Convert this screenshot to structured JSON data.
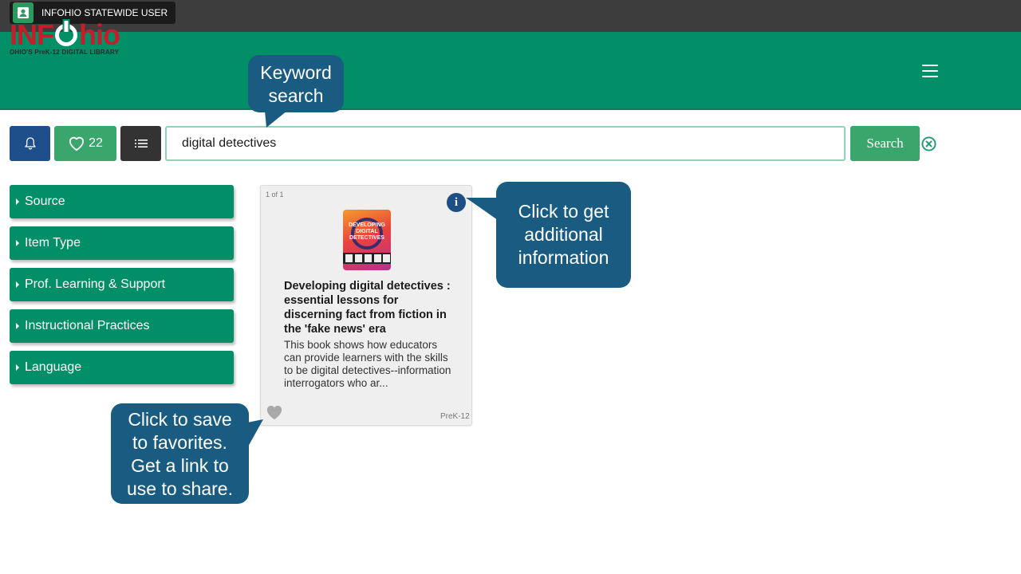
{
  "topbar": {
    "user_label": "INFOHIO STATEWIDE USER",
    "user_icon": "contact-card-icon"
  },
  "header": {
    "logo_left": "INF",
    "logo_right": "hio",
    "logo_tagline": "OHIO'S PreK-12 DIGITAL LIBRARY",
    "menu_icon": "hamburger-icon"
  },
  "toolbar": {
    "alerts_icon": "bell-icon",
    "favorites_count": "22",
    "favorites_icon": "heart-outline-icon",
    "list_icon": "list-icon",
    "search_value": "digital detectives",
    "search_label": "Search",
    "clear_icon": "circle-x-icon"
  },
  "facets": [
    {
      "label": "Source"
    },
    {
      "label": "Item Type"
    },
    {
      "label": "Prof. Learning & Support"
    },
    {
      "label": "Instructional Practices"
    },
    {
      "label": "Language"
    }
  ],
  "result": {
    "count": "1 of 1",
    "info_glyph": "i",
    "cover_text": "DEVELOPING DIGITAL DETECTIVES",
    "title": "Developing digital detectives : essential lessons for discerning fact from fiction in the 'fake news' era",
    "description": "This book shows how educators can provide learners with the skills to be digital detectives--information interrogators who ar...",
    "grade": "PreK-12"
  },
  "callouts": {
    "keyword": "Keyword search",
    "info": "Click to get additional information",
    "favorite": "Click to save to favorites. Get a link to use to share."
  },
  "colors": {
    "topbar": "#3d3d3d",
    "header_green": "#028f67",
    "button_green": "#3aa66b",
    "bell_blue": "#1f4f8a",
    "callout_blue": "#1a5b82",
    "logo_red": "#c41e2a"
  }
}
